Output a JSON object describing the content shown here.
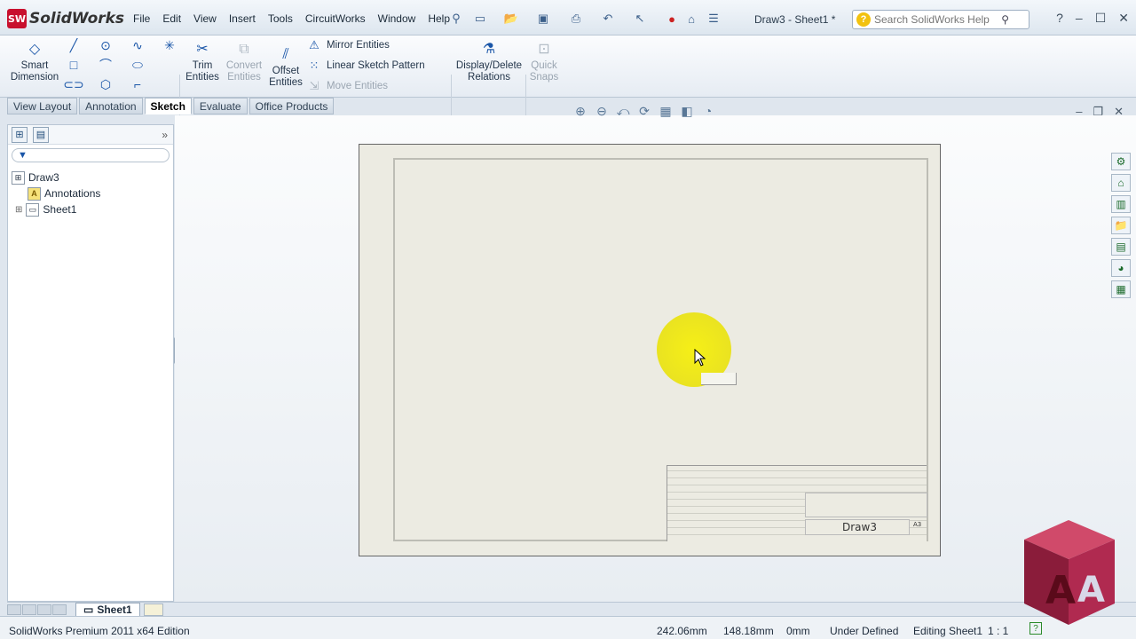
{
  "app": {
    "brand": "SolidWorks",
    "logo_letters": "SW",
    "window_title": "Draw3 - Sheet1 *"
  },
  "menu": [
    "File",
    "Edit",
    "View",
    "Insert",
    "Tools",
    "CircuitWorks",
    "Window",
    "Help"
  ],
  "search": {
    "placeholder": "Search SolidWorks Help"
  },
  "ribbon": {
    "smart_dimension": "Smart Dimension",
    "trim_entities": "Trim Entities",
    "convert_entities": "Convert Entities",
    "offset_entities": "Offset Entities",
    "mirror_entities": "Mirror Entities",
    "linear_sketch_pattern": "Linear Sketch Pattern",
    "move_entities": "Move Entities",
    "display_delete_relations": "Display/Delete Relations",
    "quick_snaps": "Quick Snaps"
  },
  "command_tabs": [
    "View Layout",
    "Annotation",
    "Sketch",
    "Evaluate",
    "Office Products"
  ],
  "active_tab": "Sketch",
  "feature_tree": {
    "root": "Draw3",
    "items": [
      "Annotations",
      "Sheet1"
    ]
  },
  "sheet": {
    "title_block_name": "Draw3",
    "size": "A3"
  },
  "bottom": {
    "sheet_tab": "Sheet1"
  },
  "status": {
    "edition": "SolidWorks Premium 2011 x64 Edition",
    "x": "242.06mm",
    "y": "148.18mm",
    "z": "0mm",
    "state": "Under Defined",
    "editing": "Editing Sheet1",
    "scale": "1 : 1"
  },
  "colors": {
    "accent": "#1a56a8",
    "logo_red": "#c8102e",
    "highlight": "#f7f000"
  }
}
